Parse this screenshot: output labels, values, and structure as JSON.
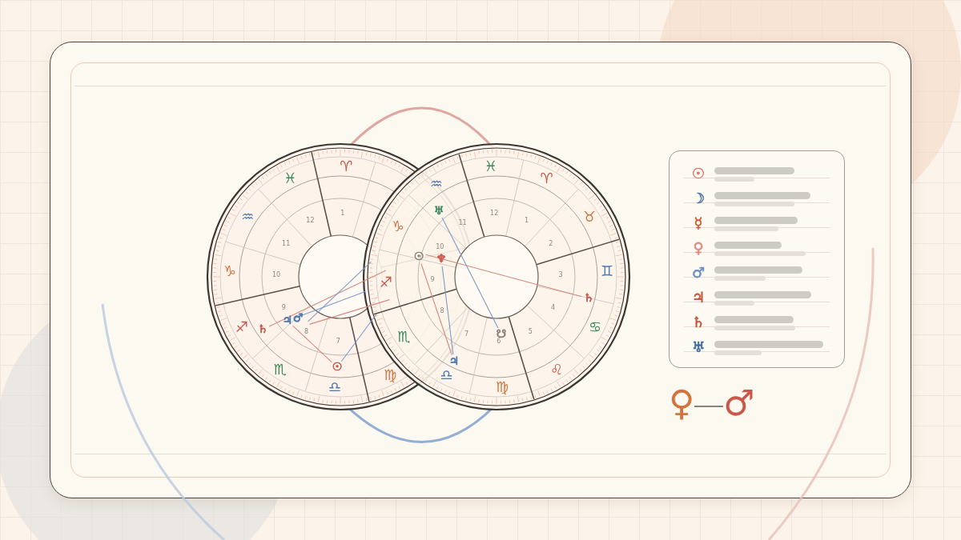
{
  "charts": [
    {
      "signs": [
        {
          "glyph": "♍",
          "color": "#d2743f"
        },
        {
          "glyph": "♎",
          "color": "#4f78b0"
        },
        {
          "glyph": "♏",
          "color": "#3d8a5c"
        },
        {
          "glyph": "♐",
          "color": "#c9574a"
        },
        {
          "glyph": "♑",
          "color": "#d2743f"
        },
        {
          "glyph": "♒",
          "color": "#4f78b0"
        },
        {
          "glyph": "♓",
          "color": "#3d8a5c"
        },
        {
          "glyph": "♈",
          "color": "#c9574a"
        }
      ],
      "houses": [
        "7",
        "8",
        "9",
        "10",
        "11",
        "12",
        "1"
      ],
      "planets": [
        {
          "glyph": "♄",
          "color": "#c9574a"
        },
        {
          "glyph": "♃",
          "color": "#4f78b0"
        },
        {
          "glyph": "♂",
          "color": "#4f78b0"
        },
        {
          "glyph": "☉",
          "color": "#c9574a"
        }
      ]
    },
    {
      "signs": [
        {
          "glyph": "♓",
          "color": "#3d8a5c"
        },
        {
          "glyph": "♈",
          "color": "#c9574a"
        },
        {
          "glyph": "♉",
          "color": "#d2743f"
        },
        {
          "glyph": "♊",
          "color": "#4f78b0"
        },
        {
          "glyph": "♋",
          "color": "#3d8a5c"
        },
        {
          "glyph": "♌",
          "color": "#c9574a"
        },
        {
          "glyph": "♍",
          "color": "#d2743f"
        },
        {
          "glyph": "♎",
          "color": "#4f78b0"
        },
        {
          "glyph": "♏",
          "color": "#3d8a5c"
        },
        {
          "glyph": "♐",
          "color": "#c9574a"
        },
        {
          "glyph": "♑",
          "color": "#d2743f"
        },
        {
          "glyph": "♒",
          "color": "#4f78b0"
        }
      ],
      "houses": [
        "12",
        "1",
        "2",
        "3",
        "4",
        "5",
        "6",
        "7",
        "8",
        "9",
        "10",
        "11"
      ],
      "planets": [
        {
          "glyph": "♅",
          "color": "#3d8a5c"
        },
        {
          "glyph": "☉",
          "color": "#8a817a"
        },
        {
          "glyph": "♆",
          "color": "#c9574a"
        },
        {
          "glyph": "♄",
          "color": "#c9574a"
        },
        {
          "glyph": "♃",
          "color": "#4f78b0"
        },
        {
          "glyph": "☋",
          "color": "#8a817a"
        }
      ]
    }
  ],
  "legend": [
    {
      "glyph": "☉",
      "color": "#d97a6c"
    },
    {
      "glyph": "☽",
      "color": "#4f78b0"
    },
    {
      "glyph": "☿",
      "color": "#c8603a"
    },
    {
      "glyph": "♀",
      "color": "#e08a80"
    },
    {
      "glyph": "♂",
      "color": "#6b90c4"
    },
    {
      "glyph": "♃",
      "color": "#c8553d"
    },
    {
      "glyph": "♄",
      "color": "#c8553d"
    },
    {
      "glyph": "♅",
      "color": "#3f6aa8"
    }
  ],
  "pair": {
    "left": {
      "glyph": "♀",
      "color": "#d2743f"
    },
    "right": {
      "glyph": "♂",
      "color": "#c9574a"
    }
  }
}
